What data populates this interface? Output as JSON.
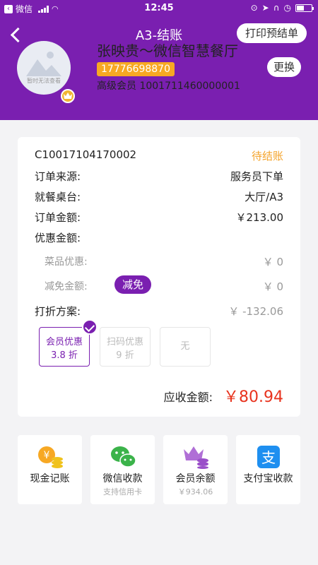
{
  "status_bar": {
    "carrier": "微信",
    "time": "12:45"
  },
  "header": {
    "title": "A3-结账",
    "print_label": "打印预结单"
  },
  "user": {
    "avatar_caption": "暂时无法查看",
    "name": "张映贵～微信智慧餐厅",
    "phone": "17776698870",
    "member_line": "高级会员 1001711460000001",
    "change_label": "更换"
  },
  "order": {
    "id": "C10017104170002",
    "status": "待结账",
    "rows": [
      {
        "label": "订单来源:",
        "value": "服务员下单"
      },
      {
        "label": "就餐桌台:",
        "value": "大厅/A3"
      },
      {
        "label": "订单金额:",
        "value": "￥213.00"
      },
      {
        "label": "优惠金额:",
        "value": ""
      }
    ],
    "dish_discount_label": "菜品优惠:",
    "dish_discount_value": "￥ 0",
    "reduce_label": "减免金额:",
    "reduce_tag": "减免",
    "reduce_value": "￥ 0",
    "plan_label": "打折方案:",
    "plan_value": "￥ -132.06",
    "plans": [
      {
        "line1": "会员优惠",
        "line2": "3.8 折",
        "selected": true
      },
      {
        "line1": "扫码优惠",
        "line2": "9 折",
        "selected": false
      },
      {
        "line1": "无",
        "line2": "",
        "selected": false
      }
    ],
    "total_label": "应收金额:",
    "total_value": "￥80.94"
  },
  "payments": [
    {
      "label": "现金记账",
      "sub": "",
      "icon": "cash-icon"
    },
    {
      "label": "微信收款",
      "sub": "支持信用卡",
      "icon": "wechat-icon"
    },
    {
      "label": "会员余额",
      "sub": "￥934.06",
      "icon": "member-crown-icon"
    },
    {
      "label": "支付宝收款",
      "sub": "",
      "icon": "alipay-icon"
    }
  ],
  "colors": {
    "primary": "#7a1fb0",
    "accent_orange": "#f7a823",
    "status": "#f4a42c",
    "total": "#e8331e"
  }
}
